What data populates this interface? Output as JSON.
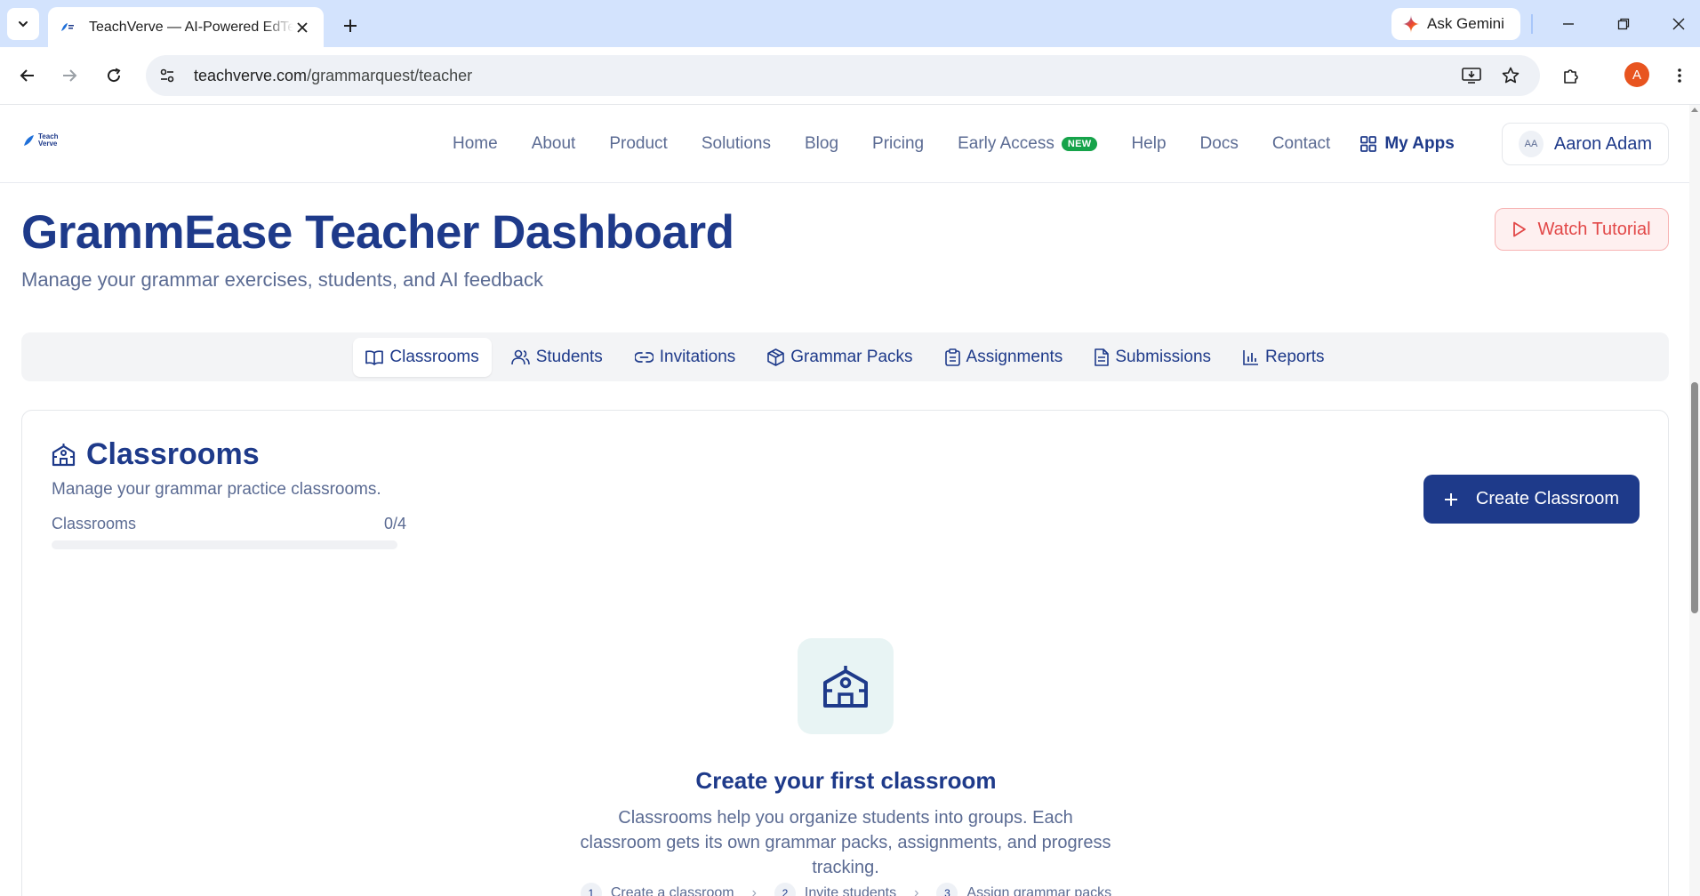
{
  "browser": {
    "tab_title": "TeachVerve — AI-Powered EdTech",
    "url_domain": "teachverve.com",
    "url_path": "/grammarquest/teacher",
    "gemini_label": "Ask Gemini",
    "profile_initial": "A"
  },
  "header": {
    "logo_line1": "Teach",
    "logo_line2": "Verve",
    "nav": [
      {
        "label": "Home"
      },
      {
        "label": "About"
      },
      {
        "label": "Product"
      },
      {
        "label": "Solutions"
      },
      {
        "label": "Blog"
      },
      {
        "label": "Pricing"
      },
      {
        "label": "Early Access",
        "badge": "NEW"
      },
      {
        "label": "Help"
      },
      {
        "label": "Docs"
      },
      {
        "label": "Contact"
      }
    ],
    "my_apps": "My Apps",
    "user_initials": "AA",
    "user_name": "Aaron Adam"
  },
  "page": {
    "title": "GrammEase Teacher Dashboard",
    "subtitle": "Manage your grammar exercises, students, and AI feedback",
    "watch_tutorial": "Watch Tutorial"
  },
  "tabs": [
    {
      "label": "Classrooms",
      "icon": "book-open-icon",
      "active": true
    },
    {
      "label": "Students",
      "icon": "users-icon"
    },
    {
      "label": "Invitations",
      "icon": "link-icon"
    },
    {
      "label": "Grammar Packs",
      "icon": "package-icon"
    },
    {
      "label": "Assignments",
      "icon": "clipboard-icon"
    },
    {
      "label": "Submissions",
      "icon": "file-text-icon"
    },
    {
      "label": "Reports",
      "icon": "bar-chart-icon"
    }
  ],
  "classrooms": {
    "title": "Classrooms",
    "description": "Manage your grammar practice classrooms.",
    "quota_label": "Classrooms",
    "quota_value": "0/4",
    "quota_fraction": 0,
    "create_button": "Create Classroom",
    "empty_title": "Create your first classroom",
    "empty_text": "Classrooms help you organize students into groups. Each classroom gets its own grammar packs, assignments, and progress tracking.",
    "steps": [
      {
        "num": "1",
        "label": "Create a classroom"
      },
      {
        "num": "2",
        "label": "Invite students"
      },
      {
        "num": "3",
        "label": "Assign grammar packs"
      }
    ]
  },
  "colors": {
    "brand_navy": "#1e3a8a",
    "muted_text": "#5b6b93",
    "new_badge": "#16a34a",
    "tutorial_red": "#e24848",
    "chrome_tabstrip": "#d3e3fd"
  }
}
